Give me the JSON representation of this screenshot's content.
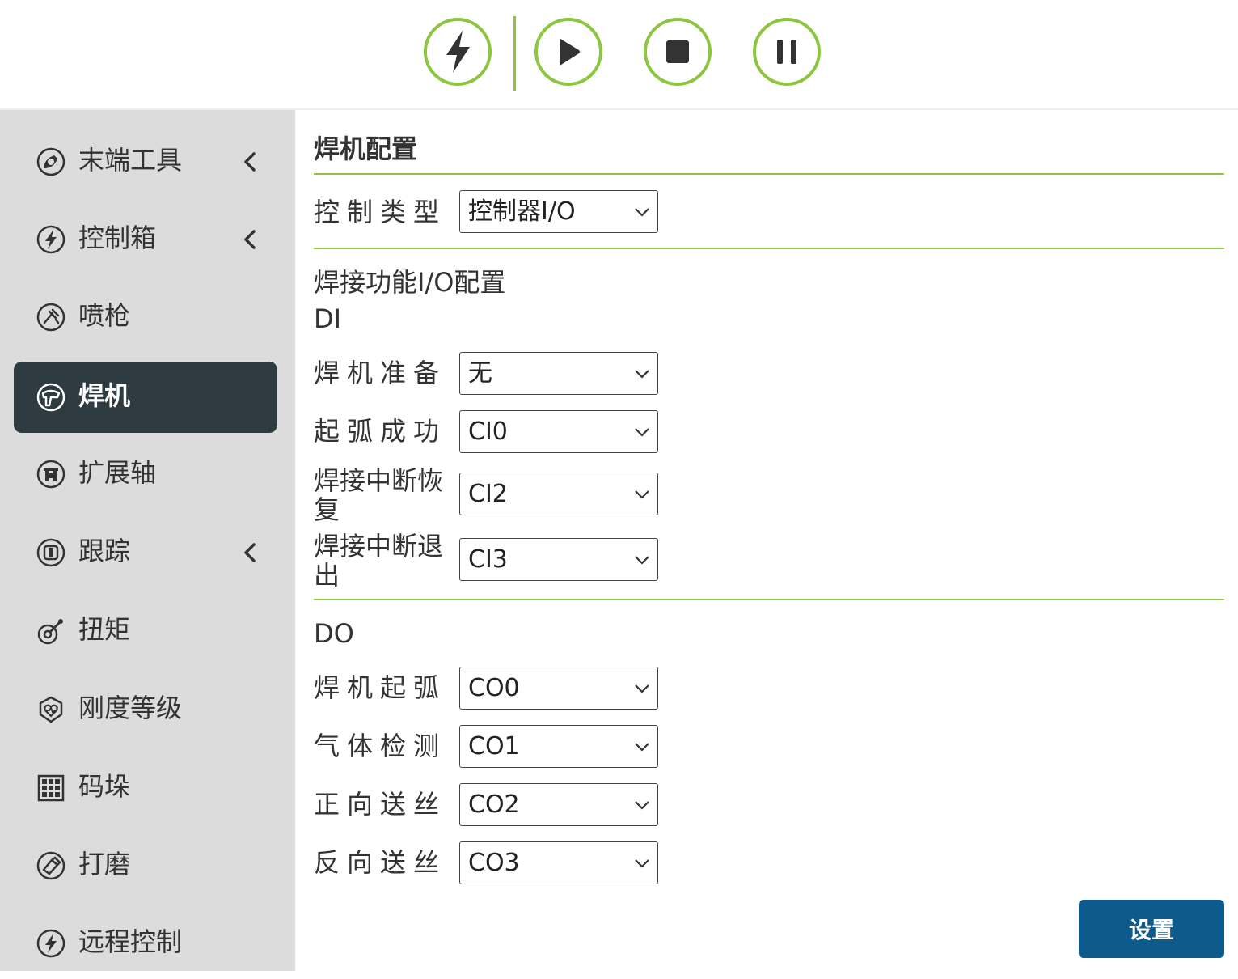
{
  "toolbar": {
    "buttons": [
      {
        "name": "power-bolt",
        "icon": "lightning-icon"
      },
      {
        "name": "play",
        "icon": "play-icon"
      },
      {
        "name": "stop",
        "icon": "stop-icon"
      },
      {
        "name": "pause",
        "icon": "pause-icon"
      }
    ],
    "accent_color": "#8cc63f"
  },
  "sidebar": {
    "items": [
      {
        "label": "末端工具",
        "icon": "tool-end-icon",
        "has_submenu": true
      },
      {
        "label": "控制箱",
        "icon": "lightning-circle-icon",
        "has_submenu": true
      },
      {
        "label": "喷枪",
        "icon": "spray-gun-icon",
        "has_submenu": false
      },
      {
        "label": "焊机",
        "icon": "welder-icon",
        "has_submenu": false,
        "active": true
      },
      {
        "label": "扩展轴",
        "icon": "extension-axis-icon",
        "has_submenu": false
      },
      {
        "label": "跟踪",
        "icon": "tracking-icon",
        "has_submenu": true
      },
      {
        "label": "扭矩",
        "icon": "torque-icon",
        "has_submenu": false
      },
      {
        "label": "刚度等级",
        "icon": "stiffness-shield-icon",
        "has_submenu": false
      },
      {
        "label": "码垛",
        "icon": "palletizing-grid-icon",
        "has_submenu": false
      },
      {
        "label": "打磨",
        "icon": "polishing-icon",
        "has_submenu": false
      },
      {
        "label": "远程控制",
        "icon": "remote-control-icon",
        "has_submenu": false
      }
    ],
    "active_color": "#2e3b40"
  },
  "main": {
    "title": "焊机配置",
    "control_type": {
      "label": "控制类型",
      "value": "控制器I/O"
    },
    "io_section_title": "焊接功能I/O配置",
    "di": {
      "heading": "DI",
      "rows": [
        {
          "label": "焊机准备",
          "value": "无"
        },
        {
          "label": "起弧成功",
          "value": "CI0"
        },
        {
          "label": "焊接中断恢复",
          "value": "CI2"
        },
        {
          "label": "焊接中断退出",
          "value": "CI3"
        }
      ]
    },
    "do": {
      "heading": "DO",
      "rows": [
        {
          "label": "焊机起弧",
          "value": "CO0"
        },
        {
          "label": "气体检测",
          "value": "CO1"
        },
        {
          "label": "正向送丝",
          "value": "CO2"
        },
        {
          "label": "反向送丝",
          "value": "CO3"
        }
      ]
    },
    "set_button_label": "设置",
    "set_button_color": "#0d5b8c"
  }
}
